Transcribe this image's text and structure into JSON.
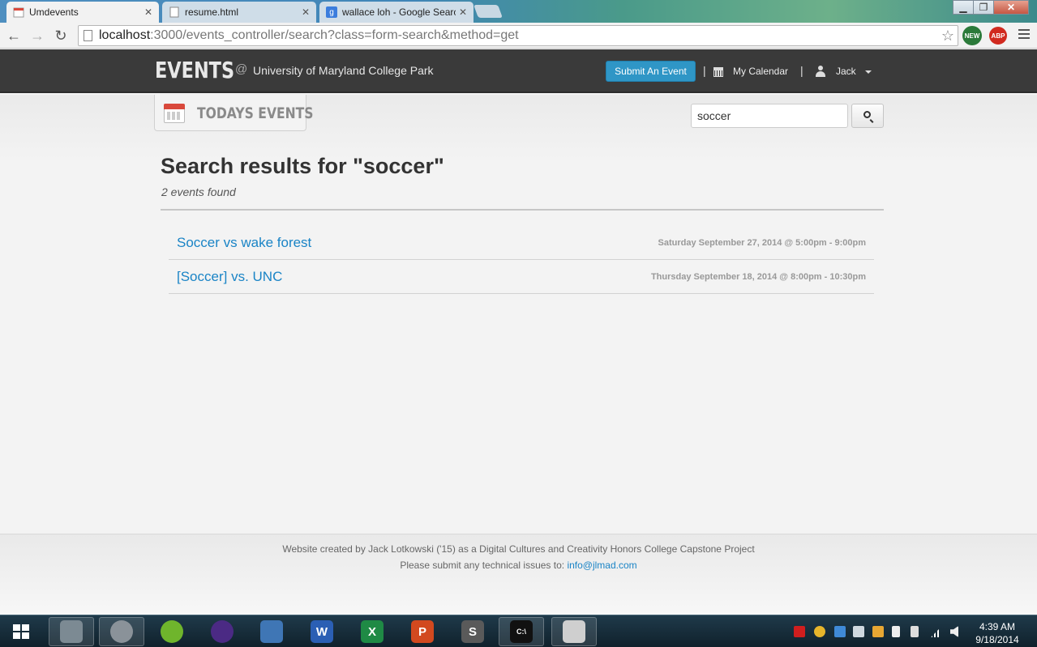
{
  "browser": {
    "tabs": [
      {
        "title": "Umdevents",
        "active": true
      },
      {
        "title": "resume.html",
        "active": false
      },
      {
        "title": "wallace loh - Google Searc",
        "active": false
      }
    ],
    "url_host": "localhost",
    "url_path": ":3000/events_controller/search?class=form-search&method=get",
    "extensions": [
      {
        "name": "new-extension-icon",
        "badge": "NEW",
        "color": "#2b7a3a"
      },
      {
        "name": "adblock-plus-icon",
        "badge": "ABP",
        "color": "#d12a1f"
      }
    ]
  },
  "header": {
    "logo": "EVENTS",
    "at": "@",
    "school": "University of Maryland College Park",
    "submit_label": "Submit An Event",
    "separator": "|",
    "my_calendar": "My Calendar",
    "user": "Jack"
  },
  "subnav": {
    "today_label": "TODAYS EVENTS",
    "search_value": "soccer"
  },
  "results": {
    "title": "Search results for \"soccer\"",
    "count": "2 events found",
    "events": [
      {
        "name": "Soccer vs wake forest",
        "when": "Saturday September 27, 2014 @ 5:00pm - 9:00pm"
      },
      {
        "name": "[Soccer] vs. UNC",
        "when": "Thursday September 18, 2014 @ 8:00pm - 10:30pm"
      }
    ]
  },
  "footer": {
    "credit": "Website created by Jack Lotkowski ('15) as a Digital Cultures and Creativity Honors College Capstone Project",
    "issues_prefix": "Please submit any technical issues to: ",
    "email": "info@jlmad.com"
  },
  "taskbar": {
    "items": [
      {
        "name": "file-explorer-icon",
        "glyph": "",
        "color": "#7c8a93",
        "framed": true
      },
      {
        "name": "chrome-icon",
        "glyph": "",
        "color": "#8a9299",
        "framed": true
      },
      {
        "name": "spotify-icon",
        "glyph": "",
        "color": "#6fb52c",
        "framed": false
      },
      {
        "name": "eclipse-icon",
        "glyph": "",
        "color": "#4b2a84",
        "framed": false
      },
      {
        "name": "virtualbox-icon",
        "glyph": "",
        "color": "#3f76b5",
        "framed": false
      },
      {
        "name": "word-icon",
        "glyph": "W",
        "color": "#2b5fb4",
        "framed": false
      },
      {
        "name": "excel-icon",
        "glyph": "X",
        "color": "#1f8a45",
        "framed": false
      },
      {
        "name": "powerpoint-icon",
        "glyph": "P",
        "color": "#d2491f",
        "framed": false
      },
      {
        "name": "sublime-text-icon",
        "glyph": "S",
        "color": "#5a5a5a",
        "framed": false
      },
      {
        "name": "command-prompt-icon",
        "glyph": "C:\\",
        "color": "#111111",
        "framed": true
      },
      {
        "name": "stacked-app-icon",
        "glyph": "",
        "color": "#cfcfcf",
        "framed": true
      }
    ],
    "time": "4:39 AM",
    "date": "9/18/2014"
  }
}
